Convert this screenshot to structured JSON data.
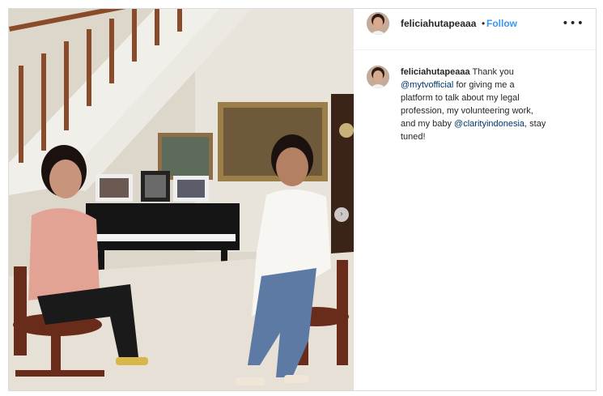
{
  "post": {
    "username": "feliciahutapeaaa",
    "separator": "•",
    "follow_label": "Follow",
    "more_icon": "•••",
    "carousel_next_icon": "›"
  },
  "caption": {
    "username": "feliciahutapeaaa",
    "text_1": "Thank you",
    "mention_1": "@mytvofficial",
    "text_2": "for giving me a platform to talk about my legal profession, my volunteering work, and my baby",
    "mention_2": "@clarityindonesia",
    "text_3": ", stay tuned!"
  }
}
